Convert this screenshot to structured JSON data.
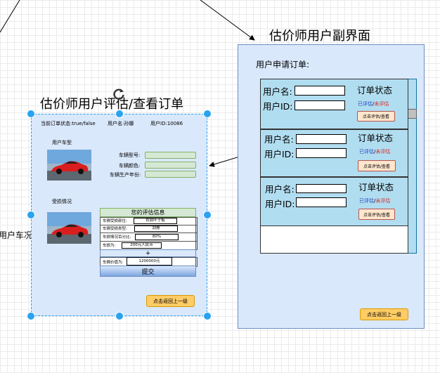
{
  "sub_screen": {
    "title": "估价师用户副界面",
    "request_label": "用户申请订单:",
    "cards": [
      {
        "name_label": "用户名:",
        "id_label": "用户ID:",
        "status_title": "订单状态",
        "status_done": "已评估",
        "status_sep": "/",
        "status_pending": "未评估",
        "button": "点击评估/查看"
      },
      {
        "name_label": "用户名:",
        "id_label": "用户ID:",
        "status_title": "订单状态",
        "status_done": "已评估",
        "status_sep": "/",
        "status_pending": "未评估",
        "button": "点击评估/查看"
      },
      {
        "name_label": "用户名:",
        "id_label": "用户ID:",
        "status_title": "订单状态",
        "status_done": "已评估",
        "status_sep": "/",
        "status_pending": "未评估",
        "button": "点击评估/查看"
      }
    ],
    "back_button": "点击返回上一级"
  },
  "review_screen": {
    "title": "估价师用户评估/查看订单",
    "order_status": "当前订单状态:true/false",
    "username": "用户名:孙娜",
    "user_id": "用户ID:10086",
    "car_type_label": "用户车型",
    "car_fields": [
      "车辆型号:",
      "车辆颜色:",
      "车辆生产年份:"
    ],
    "damage_label": "受损情况",
    "panel_title": "您的评估信息",
    "rows": [
      {
        "label": "车辆受损部位:",
        "value": "右前叶子板"
      },
      {
        "label": "车辆受损类型:",
        "value": "刮擦"
      },
      {
        "label": "车损情况百分比:",
        "value": "80%"
      },
      {
        "label": "车损为:",
        "value": "200元人民币"
      }
    ],
    "plus": "+",
    "car_value_label": "车辆价值为:",
    "car_value": "1200000元",
    "submit": "提交",
    "back_button": "点击返回上一级"
  },
  "cut_text": "用户车况",
  "colors": {
    "panel_blue": "#dae8fc",
    "panel_border": "#6c8ebf",
    "card_blue": "#b1ddf0",
    "teal": "#10739e",
    "selection": "#29a3f0",
    "orange": "#ffcc66",
    "green": "#d5e8d4"
  }
}
